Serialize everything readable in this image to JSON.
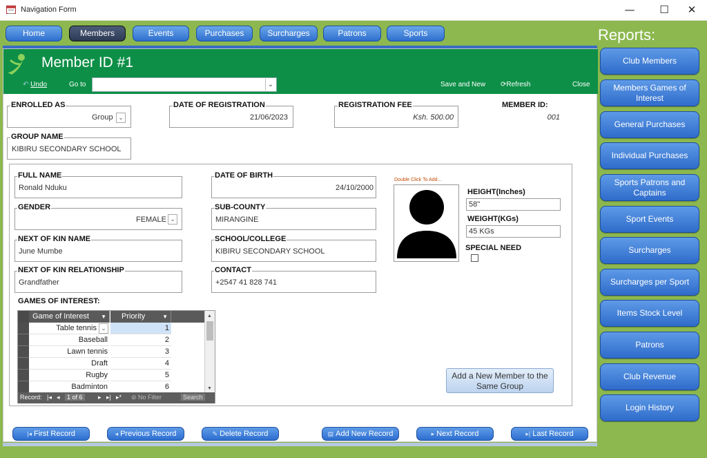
{
  "window": {
    "title": "Navigation Form",
    "minimize": "—",
    "maximize": "☐",
    "close": "✕"
  },
  "tabs": [
    "Home",
    "Members",
    "Events",
    "Purchases",
    "Surcharges",
    "Patrons",
    "Sports"
  ],
  "active_tab": "Members",
  "header": {
    "title": "Member ID #1",
    "undo": "Undo",
    "goto": "Go to",
    "goto_value": "",
    "save_new": "Save and New",
    "refresh": "Refresh",
    "close": "Close"
  },
  "registration": {
    "enrolled_as_label": "ENROLLED AS",
    "enrolled_as": "Group",
    "date_label": "DATE OF REGISTRATION",
    "date": "21/06/2023",
    "fee_label": "REGISTRATION FEE",
    "fee": "Ksh. 500.00",
    "member_id_label": "MEMBER ID:",
    "member_id": "001",
    "group_name_label": "GROUP NAME",
    "group_name": "KIBIRU SECONDARY SCHOOL"
  },
  "member": {
    "full_name_label": "FULL NAME",
    "full_name": "Ronald Nduku",
    "dob_label": "DATE OF BIRTH",
    "dob": "24/10/2000",
    "gender_label": "GENDER",
    "gender": "FEMALE",
    "subcounty_label": "SUB-COUNTY",
    "subcounty": "MIRANGINE",
    "kin_name_label": "NEXT OF KIN NAME",
    "kin_name": "June Mumbe",
    "school_label": "SCHOOL/COLLEGE",
    "school": "KIBIRU SECONDARY SCHOOL",
    "kin_rel_label": "NEXT OF KIN RELATIONSHIP",
    "kin_rel": "Grandfather",
    "contact_label": "CONTACT",
    "contact": "+2547 41 828 741",
    "photo_hint": "Double Click To Add...",
    "height_label": "HEIGHT(Inches)",
    "height": "58\"",
    "weight_label": "WEIGHT(KGs)",
    "weight": "45 KGs",
    "special_need_label": "SPECIAL NEED",
    "special_need": false
  },
  "games": {
    "label": "GAMES OF INTEREST:",
    "col_game": "Game of Interest",
    "col_priority": "Priority",
    "rows": [
      {
        "game": "Table tennis",
        "priority": "1"
      },
      {
        "game": "Baseball",
        "priority": "2"
      },
      {
        "game": "Lawn tennis",
        "priority": "3"
      },
      {
        "game": "Draft",
        "priority": "4"
      },
      {
        "game": "Rugby",
        "priority": "5"
      },
      {
        "game": "Badminton",
        "priority": "6"
      }
    ],
    "nav": {
      "record": "Record:",
      "position": "1 of 6",
      "no_filter": "No Filter",
      "search": "Search"
    }
  },
  "add_member_button": "Add a New Member to the Same Group",
  "record_nav": [
    "First Record",
    "Previous Record",
    "Delete Record",
    "Add New Record",
    "Next Record",
    "Last Record"
  ],
  "reports": {
    "title": "Reports:",
    "items": [
      "Club Members",
      "Members Games of Interest",
      "General Purchases",
      "Individual Purchases",
      "Sports Patrons and Captains",
      "Sport Events",
      "Surcharges",
      "Surcharges per Sport",
      "Items Stock Level",
      "Patrons",
      "Club Revenue",
      "Login History"
    ]
  },
  "colors": {
    "header_green": "#0d8f47",
    "frame_green": "#8cb84f",
    "button_blue": "#2f6fcf"
  }
}
